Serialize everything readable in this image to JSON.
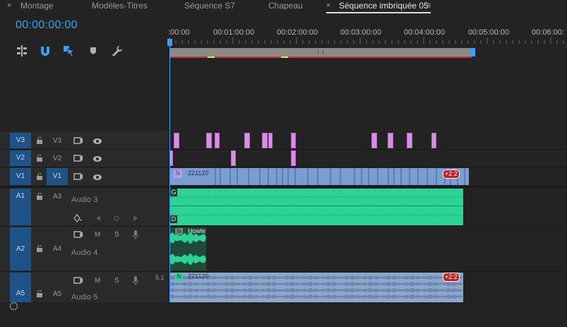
{
  "tabs": [
    {
      "close": "×",
      "label": "Montage"
    },
    {
      "label": "Modèles-Titres"
    },
    {
      "label": "Séquence S7"
    },
    {
      "label": "Chapeau"
    },
    {
      "close": "×",
      "label": "Séquence imbriquée 05",
      "menu": "≡"
    }
  ],
  "timecode": "00:00:00:00",
  "ruler": [
    ":00:00",
    "00:01:00:00",
    "00:02:00:00",
    "00:03:00:00",
    "00:04:00:00",
    "00:05:00:00",
    "00:06:00:"
  ],
  "tools": [
    "insert-edit-icon",
    "snap-magnet-icon",
    "linked-selection-icon",
    "add-marker-icon",
    "wrench-icon"
  ],
  "tracks": {
    "v3": {
      "src": "V3",
      "tgt": "V3"
    },
    "v2": {
      "src": "V2",
      "tgt": "V2"
    },
    "v1": {
      "src": "V1",
      "tgt": "V1"
    },
    "a1": {
      "src": "A1",
      "tgt": "A3",
      "name": "Audio 3"
    },
    "a2": {
      "src": "A2",
      "tgt": "A4",
      "name": "Audio 4"
    },
    "a5": {
      "src": "A5",
      "tgt": "A5",
      "name": "Audio 5",
      "channel": "5.1"
    }
  },
  "mute_label": "M",
  "solo_label": "S",
  "clips": {
    "v1_clip": "221120",
    "v1_badge": "+2:2",
    "a3_top": "G",
    "a3_bottom": "D",
    "a4_clip": "Howle",
    "a5_clip": "221120",
    "a5_badge": "+2:2",
    "fx": "fx"
  },
  "colors": {
    "accent": "#3e9ef5",
    "track_blue": "#1d5387",
    "video_clip": "#7b9dd2",
    "audio_clip": "#2bd495",
    "title_clip": "#d98ee6"
  }
}
